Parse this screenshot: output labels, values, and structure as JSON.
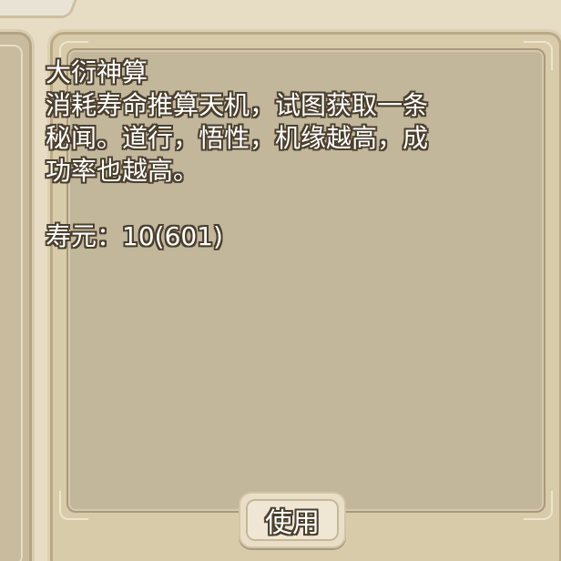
{
  "skill": {
    "title": "大衍神算",
    "description": "消耗寿命推算天机，试图获取一条秘闻。道行，悟性，机缘越高，成功率也越高。",
    "lifespan_label": "寿元：",
    "lifespan_value": "10(601)"
  },
  "actions": {
    "use_label": "使用"
  }
}
